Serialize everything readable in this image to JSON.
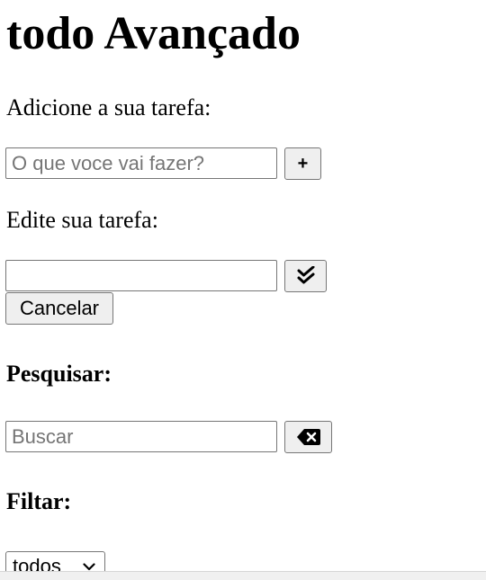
{
  "title": "todo Avançado",
  "add": {
    "label": "Adicione a sua tarefa:",
    "placeholder": "O que voce vai fazer?",
    "button": "+"
  },
  "edit": {
    "label": "Edite sua tarefa:",
    "value": "",
    "confirm_icon": "double-check-icon",
    "cancel_label": "Cancelar"
  },
  "search": {
    "label": "Pesquisar:",
    "placeholder": "Buscar",
    "clear_icon": "backspace-icon"
  },
  "filter": {
    "label": "Filtar:",
    "selected": "todos"
  }
}
